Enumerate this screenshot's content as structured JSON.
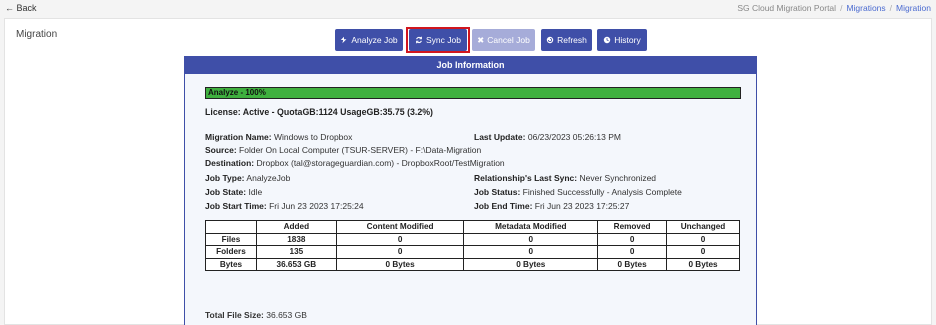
{
  "topbar": {
    "back_label": "Back",
    "breadcrumb": [
      "SG Cloud Migration Portal",
      "Migrations",
      "Migration"
    ]
  },
  "page": {
    "title": "Migration"
  },
  "toolbar": {
    "analyze_label": "Analyze Job",
    "sync_label": "Sync Job",
    "cancel_label": "Cancel Job",
    "refresh_label": "Refresh",
    "history_label": "History",
    "colors": {
      "primary": "#3f4fa8",
      "disabled": "#a6acd9",
      "highlight": "#d1161e"
    }
  },
  "job": {
    "header": "Job Information",
    "progress_label": "Analyze - 100%",
    "progress_fraction": 1.0,
    "progress_color": "#3fb03f",
    "license": "License: Active - QuotaGB:1124 UsageGB:35.75 (3.2%)",
    "migration_name_label": "Migration Name:",
    "migration_name": "Windows to Dropbox",
    "last_update_label": "Last Update:",
    "last_update": "06/23/2023 05:26:13 PM",
    "source_label": "Source:",
    "source": "Folder On Local Computer (TSUR-SERVER) - F:\\Data-Migration",
    "destination_label": "Destination:",
    "destination": "Dropbox (tal@storageguardian.com) - DropboxRoot/TestMigration",
    "job_type_label": "Job Type:",
    "job_type": "AnalyzeJob",
    "last_sync_label": "Relationship's Last Sync:",
    "last_sync": "Never Synchronized",
    "job_state_label": "Job State:",
    "job_state": "Idle",
    "job_status_label": "Job Status:",
    "job_status": "Finished Successfully - Analysis Complete",
    "start_time_label": "Job Start Time:",
    "start_time": "Fri Jun 23 2023 17:25:24",
    "end_time_label": "Job End Time:",
    "end_time": "Fri Jun 23 2023 17:25:27",
    "total_size_label": "Total File Size:",
    "total_size": "36.653 GB"
  },
  "stats": {
    "columns": [
      "",
      "Added",
      "Content Modified",
      "Metadata Modified",
      "Removed",
      "Unchanged"
    ],
    "rows": [
      [
        "Files",
        "1838",
        "0",
        "0",
        "0",
        "0"
      ],
      [
        "Folders",
        "135",
        "0",
        "0",
        "0",
        "0"
      ],
      [
        "Bytes",
        "36.653 GB",
        "0 Bytes",
        "0 Bytes",
        "0 Bytes",
        "0 Bytes"
      ]
    ]
  }
}
